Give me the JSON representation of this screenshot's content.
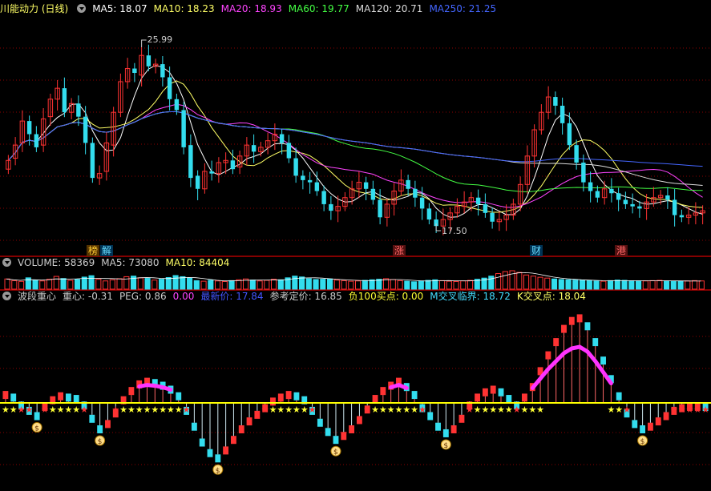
{
  "main_panel": {
    "title": "川能动力 (日线)",
    "ma_labels": [
      {
        "text": "MA5: 18.07",
        "color": "#ffffff"
      },
      {
        "text": "MA10: 18.23",
        "color": "#ffff66"
      },
      {
        "text": "MA20: 18.93",
        "color": "#ff44ff"
      },
      {
        "text": "MA60: 19.77",
        "color": "#44ff44"
      },
      {
        "text": "MA120: 20.71",
        "color": "#dddddd"
      },
      {
        "text": "MA250: 21.25",
        "color": "#4466ff"
      }
    ],
    "high_label": "25.99",
    "low_label": "17.50",
    "event_marks": [
      {
        "text": "榜",
        "color": "#ffcc33",
        "bg": "#553300"
      },
      {
        "text": "解",
        "color": "#66ddff",
        "bg": "#003355"
      },
      {
        "text": "涨",
        "color": "#ff6666",
        "bg": "#551111"
      },
      {
        "text": "财",
        "color": "#66ddff",
        "bg": "#003355"
      },
      {
        "text": "港",
        "color": "#ff6666",
        "bg": "#551111"
      }
    ]
  },
  "volume_panel": {
    "labels": [
      {
        "text": "VOLUME: 58369",
        "color": "#cccccc"
      },
      {
        "text": "MA5: 73080",
        "color": "#cccccc"
      },
      {
        "text": "MA10: 84404",
        "color": "#ffff66"
      }
    ]
  },
  "indicator_panel": {
    "labels": [
      {
        "text": "波段重心",
        "color": "#cccccc"
      },
      {
        "text": "重心: -0.31",
        "color": "#cccccc"
      },
      {
        "text": "PEG: 0.86",
        "color": "#cccccc"
      },
      {
        "text": "0.00",
        "color": "#ff44ff"
      },
      {
        "text": "最新价: 17.84",
        "color": "#4455ff"
      },
      {
        "text": "参考定价: 16.85",
        "color": "#cccccc"
      },
      {
        "text": "负100买点: 0.00",
        "color": "#ffff33"
      },
      {
        "text": "M交叉临界: 18.72",
        "color": "#44ddff"
      },
      {
        "text": "K交叉点: 18.04",
        "color": "#ffff66"
      }
    ]
  },
  "colors": {
    "up": "#ff3333",
    "down": "#33ddee",
    "grid": "#8b0000",
    "baseline": "#ffff00"
  },
  "chart_data": [
    {
      "type": "candlestick",
      "title": "川能动力 (日线)",
      "ylim": [
        16.4,
        27.2
      ],
      "bars": 79,
      "close": [
        20.6,
        21.3,
        22.4,
        21.8,
        21.2,
        22.5,
        23.4,
        23.9,
        22.8,
        23.2,
        22.6,
        21.4,
        19.8,
        20.0,
        21.4,
        22.8,
        24.2,
        24.8,
        24.6,
        25.4,
        24.9,
        25.0,
        24.4,
        23.4,
        22.9,
        21.2,
        19.8,
        19.3,
        20.1,
        20.0,
        20.5,
        20.6,
        20.2,
        20.8,
        21.3,
        21.0,
        21.2,
        21.5,
        21.8,
        21.4,
        20.7,
        19.9,
        19.7,
        19.6,
        19.2,
        18.6,
        18.3,
        18.5,
        18.9,
        19.3,
        19.6,
        19.3,
        18.8,
        18.0,
        18.6,
        19.2,
        19.7,
        19.3,
        18.9,
        18.4,
        17.9,
        17.6,
        17.9,
        18.2,
        18.5,
        18.7,
        18.9,
        18.6,
        18.2,
        17.8,
        17.9,
        18.1,
        18.6,
        19.5,
        20.8,
        22.0,
        22.8,
        23.5,
        23.1,
        22.3,
        21.3,
        20.5,
        19.6,
        19.2,
        18.9,
        19.3,
        19.1,
        18.8,
        18.6,
        18.5,
        18.4,
        18.7,
        18.9,
        19.0,
        18.8,
        18.1,
        18.0,
        18.1,
        18.2,
        18.3
      ],
      "open": [
        20.2,
        20.7,
        21.4,
        22.4,
        21.8,
        21.3,
        22.6,
        23.4,
        23.9,
        22.8,
        23.2,
        22.6,
        21.4,
        19.8,
        20.1,
        21.3,
        22.8,
        24.2,
        24.8,
        24.5,
        25.4,
        24.9,
        25.0,
        24.4,
        23.4,
        22.9,
        21.3,
        19.9,
        19.3,
        20.1,
        20.0,
        20.5,
        20.6,
        20.3,
        20.8,
        21.3,
        21.0,
        21.2,
        21.5,
        21.8,
        21.4,
        20.7,
        19.9,
        19.7,
        19.6,
        19.2,
        18.6,
        18.3,
        18.5,
        18.9,
        19.3,
        19.6,
        19.3,
        18.8,
        18.0,
        18.6,
        19.2,
        19.7,
        19.3,
        18.9,
        18.4,
        17.9,
        17.6,
        17.9,
        18.2,
        18.5,
        18.7,
        18.9,
        18.6,
        18.2,
        17.8,
        17.9,
        18.1,
        18.6,
        19.5,
        20.8,
        22.0,
        22.8,
        23.5,
        23.1,
        22.3,
        21.3,
        20.5,
        19.6,
        19.2,
        18.9,
        19.3,
        19.1,
        18.8,
        18.6,
        18.5,
        18.4,
        18.7,
        18.9,
        19.0,
        18.8,
        18.1,
        18.0,
        18.1,
        18.2
      ],
      "high_marker": 25.99,
      "low_marker": 17.5,
      "ma_last": {
        "MA5": 18.07,
        "MA10": 18.23,
        "MA20": 18.93,
        "MA60": 19.77,
        "MA120": 20.71,
        "MA250": 21.25
      }
    },
    {
      "type": "bar",
      "title": "VOLUME",
      "values": [
        72,
        60,
        55,
        80,
        65,
        58,
        70,
        90,
        75,
        62,
        68,
        85,
        95,
        70,
        58,
        66,
        74,
        88,
        92,
        80,
        76,
        64,
        70,
        82,
        96,
        88,
        78,
        60,
        56,
        62,
        58,
        54,
        60,
        66,
        72,
        64,
        58,
        62,
        70,
        66,
        80,
        92,
        86,
        74,
        68,
        70,
        72,
        64,
        60,
        56,
        58,
        62,
        66,
        70,
        74,
        68,
        60,
        56,
        52,
        58,
        62,
        66,
        60,
        56,
        54,
        58,
        62,
        70,
        78,
        92,
        110,
        124,
        130,
        118,
        100,
        92,
        84,
        78,
        72,
        68,
        66,
        64,
        62,
        60,
        58,
        56,
        60,
        64,
        62,
        58,
        56,
        58,
        60,
        62,
        58,
        56,
        54,
        58,
        60,
        58
      ],
      "last": {
        "VOLUME": 58369,
        "MA5": 73080,
        "MA10": 84404
      }
    },
    {
      "type": "bar",
      "title": "波段重心",
      "values": [
        0.6,
        0.4,
        -0.2,
        -0.6,
        -1.0,
        -0.3,
        0.2,
        0.5,
        0.4,
        0.3,
        -0.2,
        -1.2,
        -2.0,
        -1.6,
        -0.8,
        0.2,
        0.9,
        1.4,
        1.6,
        1.5,
        1.3,
        1.0,
        0.5,
        -0.6,
        -1.8,
        -3.0,
        -3.8,
        -4.2,
        -3.6,
        -2.8,
        -2.0,
        -1.4,
        -0.9,
        -0.4,
        0.1,
        0.4,
        0.6,
        0.5,
        0.2,
        -0.6,
        -1.5,
        -2.2,
        -2.8,
        -2.5,
        -2.0,
        -1.3,
        -0.5,
        0.3,
        0.9,
        1.3,
        1.6,
        1.2,
        0.6,
        -0.4,
        -1.0,
        -1.8,
        -2.3,
        -2.0,
        -1.2,
        -0.2,
        0.4,
        0.8,
        1.0,
        0.8,
        0.3,
        -0.2,
        0.4,
        1.2,
        2.4,
        3.6,
        4.6,
        5.6,
        6.2,
        6.4,
        5.8,
        4.6,
        3.2,
        1.8,
        0.5,
        -0.8,
        -1.6,
        -2.0,
        -1.8,
        -1.4,
        -1.0,
        -0.6,
        -0.4,
        -0.3,
        -0.3,
        -0.31
      ],
      "baseline": 0,
      "last": {
        "重心": -0.31,
        "PEG": 0.86
      }
    }
  ]
}
